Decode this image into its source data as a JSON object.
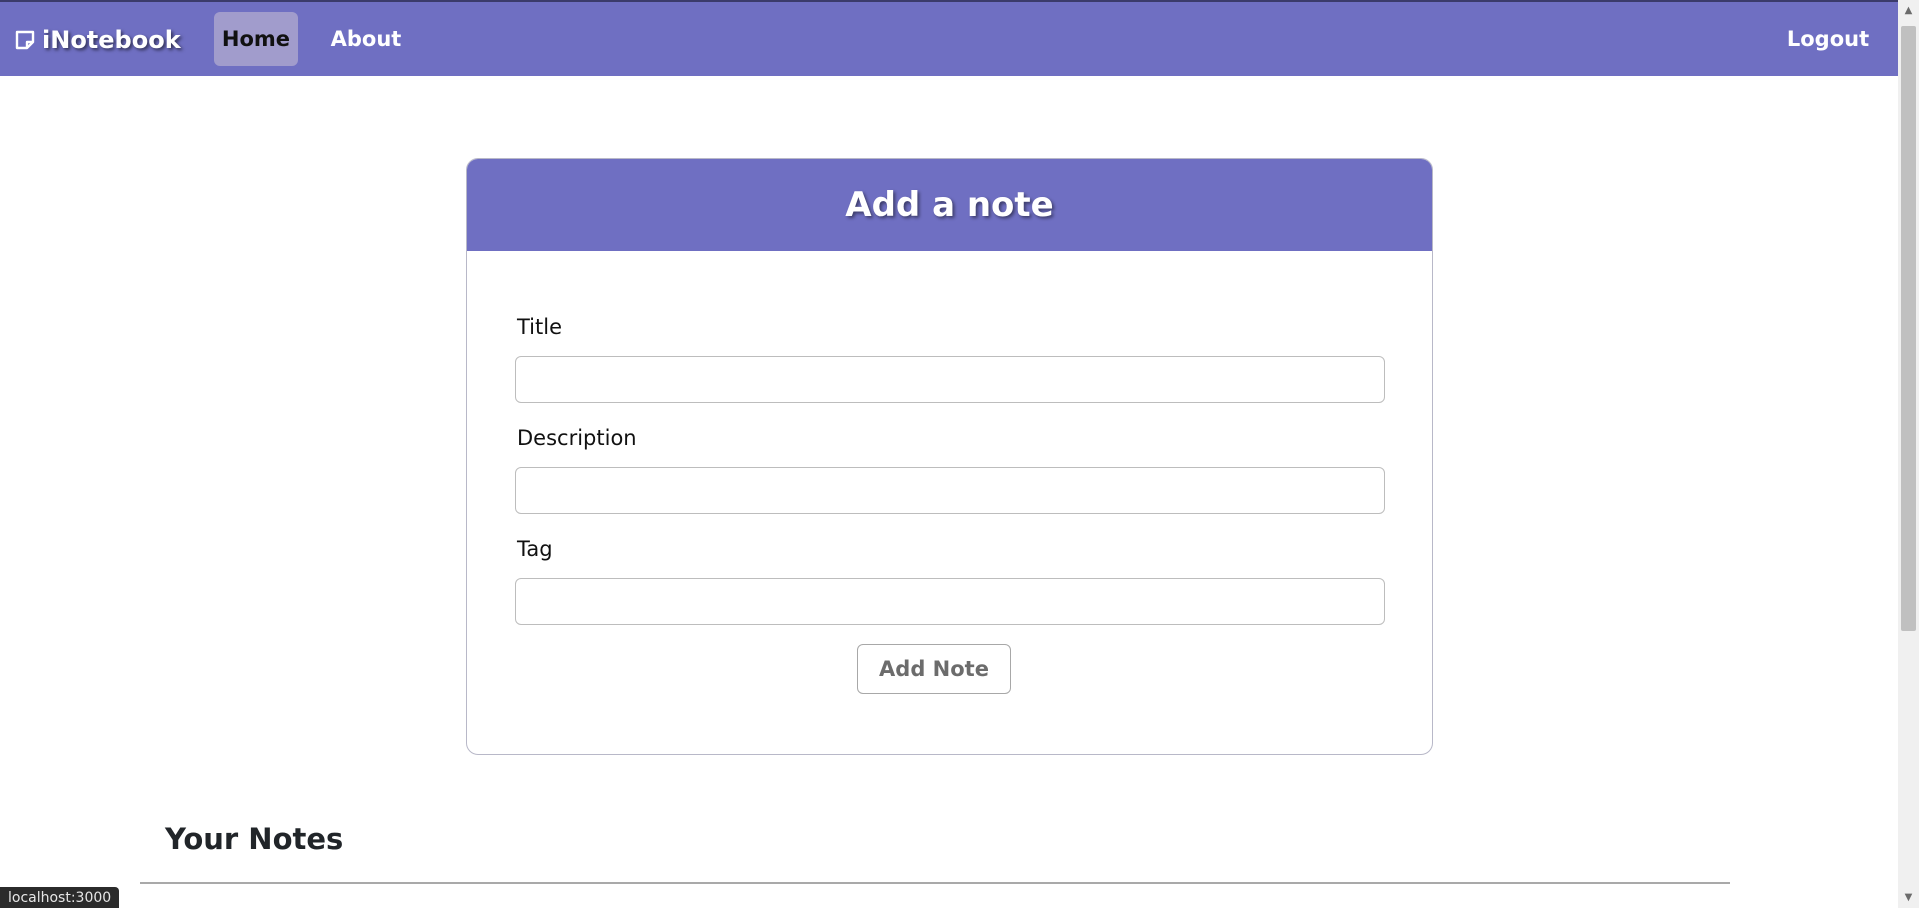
{
  "colors": {
    "accent": "#6f6fc2",
    "active_tab_bg": "#a19ccc"
  },
  "navbar": {
    "brand_icon": "note-icon",
    "brand": "iNotebook",
    "links": [
      {
        "label": "Home",
        "active": true
      },
      {
        "label": "About",
        "active": false
      }
    ],
    "logout_label": "Logout"
  },
  "form": {
    "heading": "Add a note",
    "fields": [
      {
        "label": "Title",
        "value": "",
        "placeholder": ""
      },
      {
        "label": "Description",
        "value": "",
        "placeholder": ""
      },
      {
        "label": "Tag",
        "value": "",
        "placeholder": ""
      }
    ],
    "submit_label": "Add Note"
  },
  "notes_section": {
    "heading": "Your Notes"
  },
  "status_bar": {
    "url": "localhost:3000"
  }
}
